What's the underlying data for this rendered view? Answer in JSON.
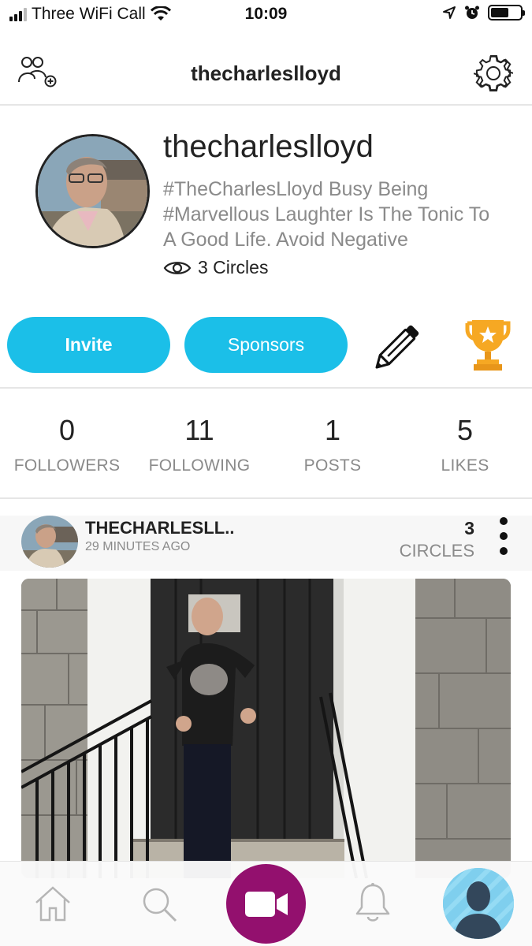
{
  "status_bar": {
    "carrier": "Three WiFi Call",
    "time": "10:09",
    "battery_level": 0.6
  },
  "header": {
    "title": "thecharleslloyd",
    "left_icon": "add-friend-icon",
    "right_icon": "gear-icon"
  },
  "profile": {
    "name": "thecharleslloyd",
    "bio_lines": [
      "#TheCharlesLloyd Busy Being",
      "#Marvellous Laughter Is The Tonic To",
      "A Good Life. Avoid Negative"
    ],
    "circles": "3 Circles"
  },
  "actions": {
    "invite": "Invite",
    "sponsors": "Sponsors"
  },
  "stats": [
    {
      "value": "0",
      "label": "FOLLOWERS"
    },
    {
      "value": "11",
      "label": "FOLLOWING"
    },
    {
      "value": "1",
      "label": "POSTS"
    },
    {
      "value": "5",
      "label": "LIKES"
    }
  ],
  "post": {
    "username": "THECHARLESLL..",
    "time": "29 MINUTES AGO",
    "circles_count": "3",
    "circles_label": "CIRCLES"
  },
  "tabs": [
    "home-icon",
    "search-icon",
    "video-camera-icon",
    "bell-icon",
    "avatar"
  ],
  "colors": {
    "accent": "#1bbfe8",
    "record": "#93106e",
    "trophy": "#f6a823"
  }
}
